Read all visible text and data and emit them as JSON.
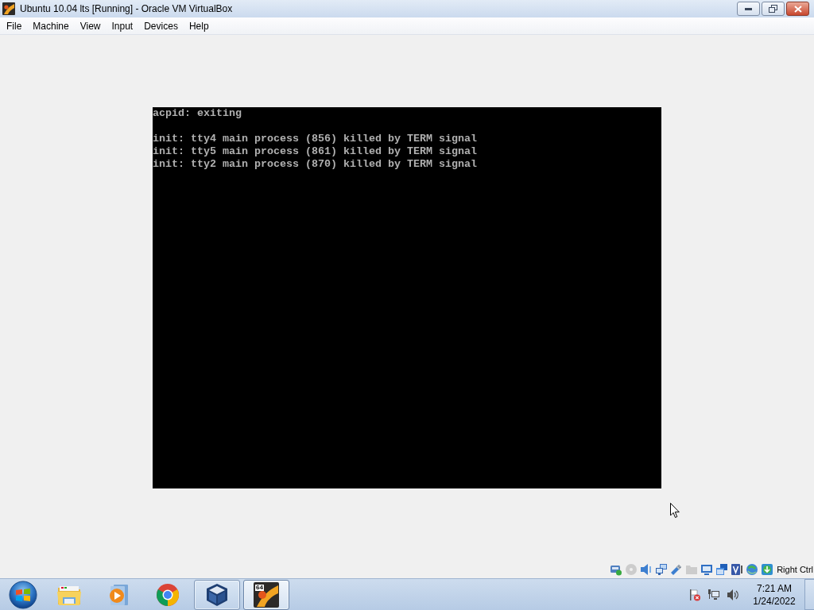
{
  "window": {
    "title": "Ubuntu 10.04 lts [Running] - Oracle VM VirtualBox"
  },
  "menu": [
    "File",
    "Machine",
    "View",
    "Input",
    "Devices",
    "Help"
  ],
  "console": {
    "blocks": [
      [
        "acpid: exiting"
      ],
      [
        "init: tty4 main process (856) killed by TERM signal",
        "init: tty5 main process (861) killed by TERM signal",
        "init: tty2 main process (870) killed by TERM signal"
      ]
    ]
  },
  "status_bar": {
    "indicators": [
      {
        "kind": "hard-disk",
        "enabled": true
      },
      {
        "kind": "optical-disc",
        "enabled": false
      },
      {
        "kind": "audio",
        "enabled": true
      },
      {
        "kind": "network",
        "enabled": true
      },
      {
        "kind": "usb",
        "enabled": true
      },
      {
        "kind": "shared-folder",
        "enabled": false
      },
      {
        "kind": "display",
        "enabled": true
      },
      {
        "kind": "recording",
        "enabled": true
      },
      {
        "kind": "virtualization",
        "enabled": true
      },
      {
        "kind": "mouse-integration",
        "enabled": true
      },
      {
        "kind": "keyboard",
        "enabled": true
      }
    ],
    "host_key": "Right Ctrl"
  },
  "taskbar": {
    "items": [
      {
        "kind": "folder",
        "running": false,
        "active": false
      },
      {
        "kind": "media-player",
        "running": false,
        "active": false
      },
      {
        "kind": "browser",
        "running": false,
        "active": false
      },
      {
        "kind": "cube",
        "running": true,
        "active": false
      },
      {
        "kind": "vm-window",
        "running": true,
        "active": true,
        "badge": "64"
      }
    ],
    "tray": [
      {
        "kind": "flag-alert"
      },
      {
        "kind": "network"
      },
      {
        "kind": "volume"
      }
    ],
    "clock": {
      "time": "7:21 AM",
      "date": "1/24/2022"
    }
  }
}
